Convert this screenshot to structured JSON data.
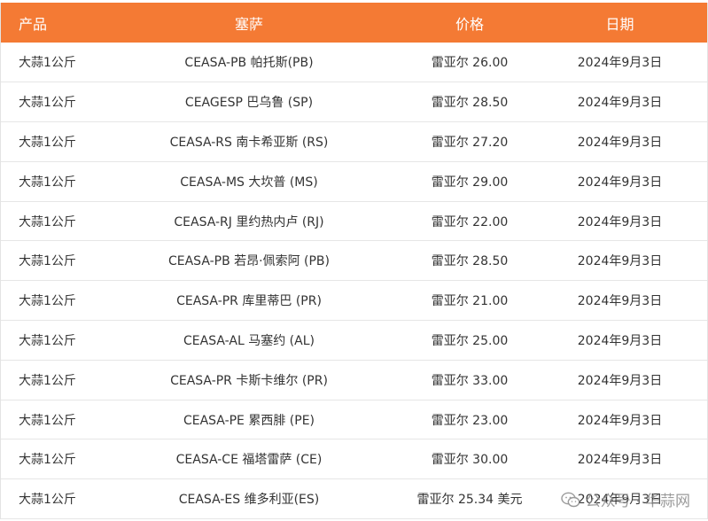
{
  "table": {
    "headers": {
      "product": "产品",
      "ceasa": "塞萨",
      "price": "价格",
      "date": "日期"
    },
    "rows": [
      {
        "product": "大蒜1公斤",
        "ceasa": "CEASA-PB 帕托斯(PB)",
        "price": "雷亚尔 26.00",
        "date": "2024年9月3日"
      },
      {
        "product": "大蒜1公斤",
        "ceasa": "CEAGESP 巴乌鲁 (SP)",
        "price": "雷亚尔 28.50",
        "date": "2024年9月3日"
      },
      {
        "product": "大蒜1公斤",
        "ceasa": "CEASA-RS 南卡希亚斯 (RS)",
        "price": "雷亚尔 27.20",
        "date": "2024年9月3日"
      },
      {
        "product": "大蒜1公斤",
        "ceasa": "CEASA-MS 大坎普 (MS)",
        "price": "雷亚尔 29.00",
        "date": "2024年9月3日"
      },
      {
        "product": "大蒜1公斤",
        "ceasa": "CEASA-RJ 里约热内卢 (RJ)",
        "price": "雷亚尔 22.00",
        "date": "2024年9月3日"
      },
      {
        "product": "大蒜1公斤",
        "ceasa": "CEASA-PB 若昂·佩索阿 (PB)",
        "price": "雷亚尔 28.50",
        "date": "2024年9月3日"
      },
      {
        "product": "大蒜1公斤",
        "ceasa": "CEASA-PR 库里蒂巴 (PR)",
        "price": "雷亚尔 21.00",
        "date": "2024年9月3日"
      },
      {
        "product": "大蒜1公斤",
        "ceasa": "CEASA-AL 马塞约 (AL)",
        "price": "雷亚尔 25.00",
        "date": "2024年9月3日"
      },
      {
        "product": "大蒜1公斤",
        "ceasa": "CEASA-PR 卡斯卡维尔 (PR)",
        "price": "雷亚尔 33.00",
        "date": "2024年9月3日"
      },
      {
        "product": "大蒜1公斤",
        "ceasa": "CEASA-PE 累西腓 (PE)",
        "price": "雷亚尔 23.00",
        "date": "2024年9月3日"
      },
      {
        "product": "大蒜1公斤",
        "ceasa": "CEASA-CE 福塔雷萨 (CE)",
        "price": "雷亚尔 30.00",
        "date": "2024年9月3日"
      },
      {
        "product": "大蒜1公斤",
        "ceasa": "CEASA-ES 维多利亚(ES)",
        "price": "雷亚尔 25.34 美元",
        "date": "2024年9月3日"
      }
    ]
  },
  "watermark": {
    "text": "公众号 · 华蒜网",
    "icon": "wechat-icon"
  },
  "colors": {
    "header_bg": "#f47a34",
    "header_text": "#ffffff"
  }
}
